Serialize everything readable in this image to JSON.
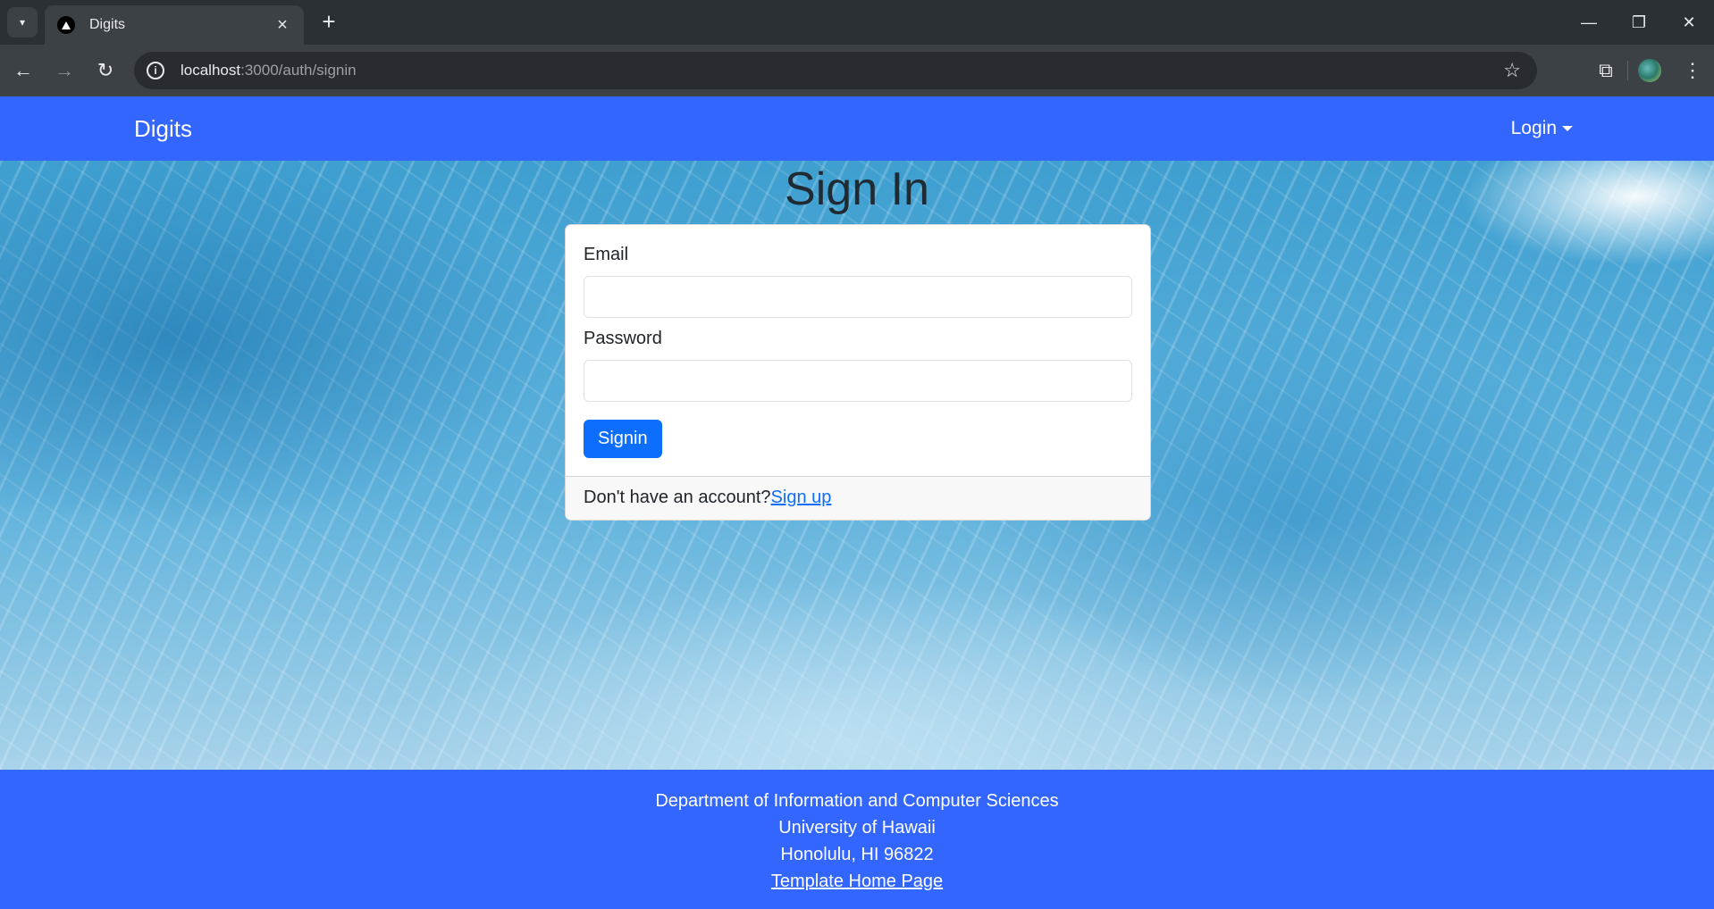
{
  "browser": {
    "tab_title": "Digits",
    "url_host": "localhost",
    "url_path": ":3000/auth/signin"
  },
  "navbar": {
    "brand": "Digits",
    "login_label": "Login"
  },
  "signin": {
    "title": "Sign In",
    "email_label": "Email",
    "password_label": "Password",
    "submit_label": "Signin",
    "footer_text": "Don't have an account?",
    "signup_link": "Sign up"
  },
  "footer": {
    "line1": "Department of Information and Computer Sciences",
    "line2": "University of Hawaii",
    "line3": "Honolulu, HI 96822",
    "link": "Template Home Page"
  },
  "colors": {
    "brand_blue": "#3366ff",
    "button_blue": "#0d6efd"
  }
}
